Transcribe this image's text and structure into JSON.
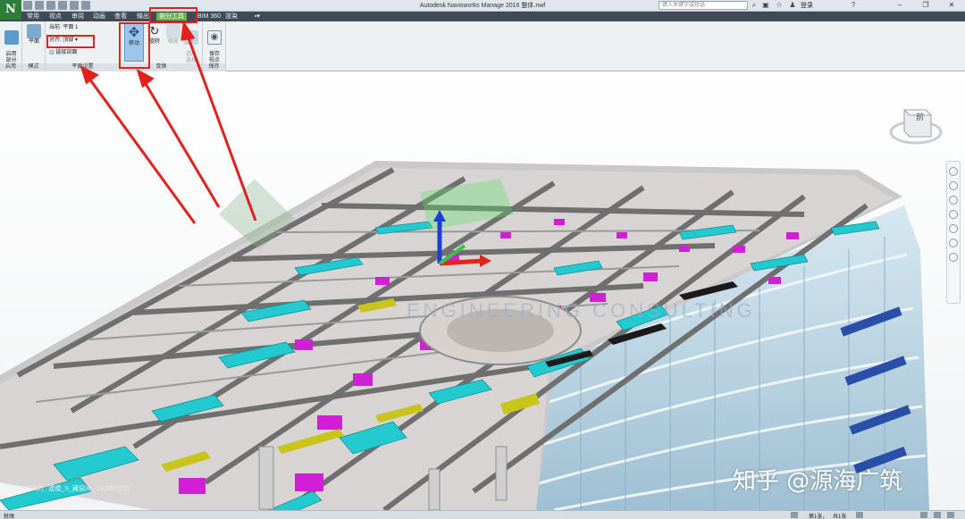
{
  "app": {
    "logo": "N",
    "window_title": "Autodesk Navisworks Manage 2016   整体.nwf",
    "search_placeholder": "键入关键字或短语",
    "login": "登录"
  },
  "ribbon_tabs": [
    {
      "label": "常用"
    },
    {
      "label": "视点"
    },
    {
      "label": "审阅"
    },
    {
      "label": "动画"
    },
    {
      "label": "查看"
    },
    {
      "label": "输出"
    },
    {
      "label": "剖分工具"
    },
    {
      "label": "BIM 360"
    },
    {
      "label": "渲染"
    }
  ],
  "ribbon": {
    "enable_section_label": "启用\n剖分",
    "group_enable": "启用",
    "plane_label": "平面",
    "group_mode": "模式",
    "current_plane": "当前: 平面 1",
    "align_label": "对齐: 顶部",
    "link_section_label": "链接剖面",
    "group_plane_settings": "平面设置",
    "move_label": "移动",
    "rotate_label": "旋转",
    "scale_label": "缩放",
    "fit_selection_label": "适应\n选择",
    "group_transform": "变换",
    "save_viewpoint_label": "保存\n视点",
    "group_save": "保存"
  },
  "viewport": {
    "viewcube_face": "前",
    "coord_readout": "L(-2)-7(2) : 建模_S_藏窑间_-14.500 (7S)",
    "watermark": "知乎 @源海广筑",
    "background_logo_text": "ENGINEERING CONSULTING"
  },
  "status": {
    "text": "就绪",
    "page_current": "第1张，",
    "page_total": "共1张"
  },
  "colors": {
    "accent_green": "#6fb04a",
    "tab_bar": "#3f4a56",
    "annotation_red": "#e0221b",
    "duct_cyan": "#22c9cf",
    "equipment_magenta": "#d21fd7",
    "structure_gray": "#7d7d7d",
    "glass_blue": "#b9d4e3"
  }
}
